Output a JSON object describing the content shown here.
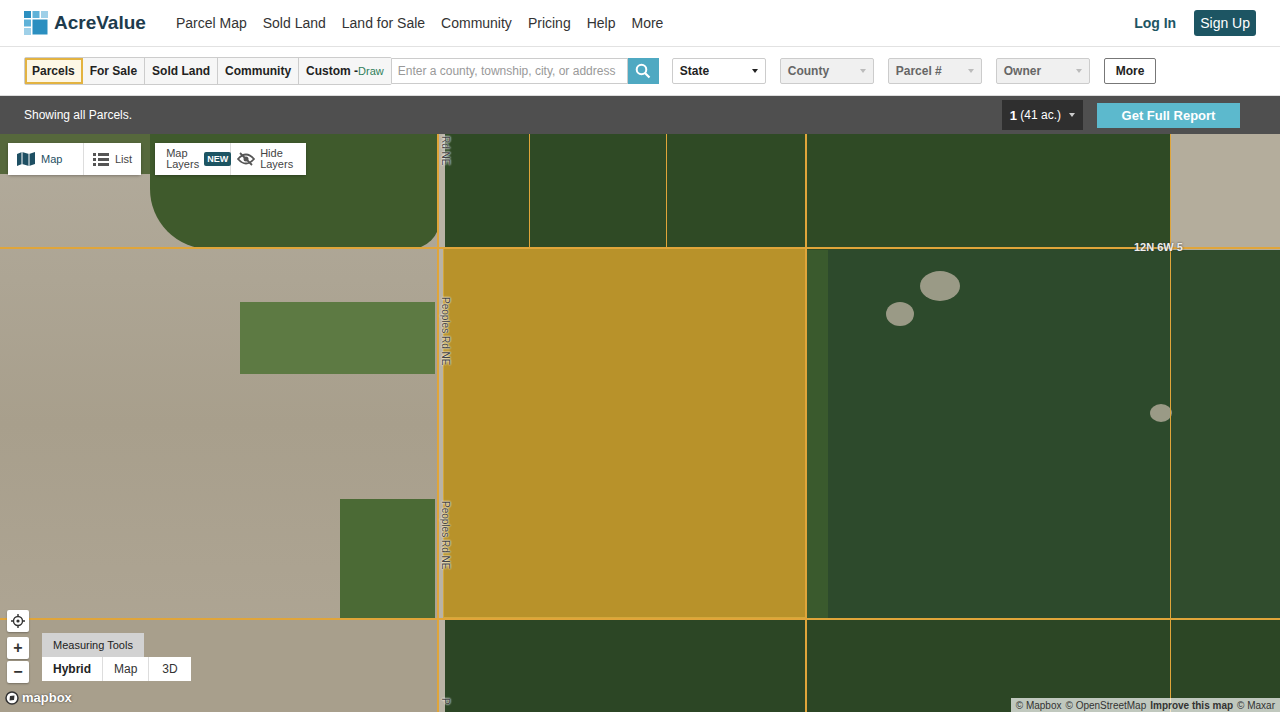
{
  "logo": {
    "text": "AcreValue"
  },
  "nav": {
    "links": [
      "Parcel Map",
      "Sold Land",
      "Land for Sale",
      "Community",
      "Pricing",
      "Help",
      "More"
    ],
    "login": "Log In",
    "signup": "Sign Up"
  },
  "filters": {
    "tabs": [
      {
        "label": "Parcels",
        "sub": "",
        "selected": true
      },
      {
        "label": "For Sale",
        "sub": "",
        "selected": false
      },
      {
        "label": "Sold Land",
        "sub": "",
        "selected": false
      },
      {
        "label": "Community",
        "sub": "",
        "selected": false
      },
      {
        "label": "Custom -",
        "sub": "Draw",
        "selected": false
      }
    ],
    "search": {
      "placeholder": "Enter a county, township, city, or address"
    },
    "dropdowns": [
      {
        "label": "State",
        "disabled": false
      },
      {
        "label": "County",
        "disabled": true
      },
      {
        "label": "Parcel #",
        "disabled": true
      },
      {
        "label": "Owner",
        "disabled": true
      }
    ],
    "more": "More"
  },
  "status_bar": {
    "text": "Showing all Parcels.",
    "selection": {
      "count": "1",
      "acres": "(41 ac.)"
    },
    "report": "Get Full Report"
  },
  "map": {
    "view_toggle": [
      {
        "label": "Map",
        "selected": true
      },
      {
        "label": "List",
        "selected": false
      }
    ],
    "layers": {
      "label": "Map Layers",
      "badge": "NEW"
    },
    "hide": "Hide Layers",
    "road_labels": [
      "Rd NE",
      "Peoples Rd NE",
      "Peoples Rd NE",
      "P"
    ],
    "section_label": "12N 6W 5",
    "parcel": {
      "selected": true
    },
    "zoom": [
      "+",
      "−"
    ],
    "measuring": "Measuring Tools",
    "styles": [
      {
        "label": "Hybrid",
        "selected": true
      },
      {
        "label": "Map",
        "selected": false
      },
      {
        "label": "3D",
        "selected": false
      }
    ],
    "brand": "mapbox",
    "attribution": [
      "© Mapbox",
      "© OpenStreetMap",
      "Improve this map",
      "© Maxar"
    ]
  }
}
